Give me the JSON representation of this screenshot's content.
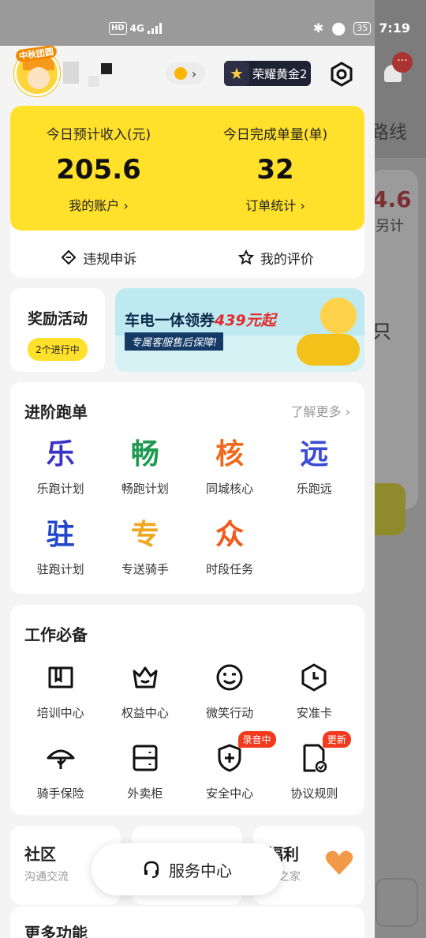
{
  "status_bar": {
    "hd": "HD",
    "network": "4G",
    "battery": "35",
    "time": "7:19"
  },
  "header": {
    "avatar_badge": "中秋团圆",
    "rank_label": "荣耀黄金2"
  },
  "income": {
    "expected_income_label": "今日预计收入(元)",
    "expected_income_value": "205.6",
    "account_link": "我的账户 ›",
    "orders_label": "今日完成单量(单)",
    "orders_value": "32",
    "orders_link": "订单统计 ›",
    "appeal_label": "违规申诉",
    "review_label": "我的评价"
  },
  "reward": {
    "title": "奖励活动",
    "badge": "2个进行中",
    "banner_headline_prefix": "车电一体领券",
    "banner_headline_amount": "439元起",
    "banner_sub": "专属客服售后保障!"
  },
  "advanced": {
    "title": "进阶跑单",
    "more": "了解更多 ›",
    "items": [
      {
        "glyph": "乐",
        "label": "乐跑计划",
        "color": "#3b32c8"
      },
      {
        "glyph": "畅",
        "label": "畅跑计划",
        "color": "#1e9a52"
      },
      {
        "glyph": "核",
        "label": "同城核心",
        "color": "#ef6a1c"
      },
      {
        "glyph": "远",
        "label": "乐跑远",
        "color": "#3a4bd6"
      },
      {
        "glyph": "驻",
        "label": "驻跑计划",
        "color": "#2147c8"
      },
      {
        "glyph": "专",
        "label": "专送骑手",
        "color": "#f0a71d"
      },
      {
        "glyph": "众",
        "label": "时段任务",
        "color": "#f05a1c"
      }
    ]
  },
  "essentials": {
    "title": "工作必备",
    "items": [
      {
        "label": "培训中心",
        "icon": "book-icon"
      },
      {
        "label": "权益中心",
        "icon": "crown-icon"
      },
      {
        "label": "微笑行动",
        "icon": "smile-icon"
      },
      {
        "label": "安准卡",
        "icon": "clock-shield-icon"
      },
      {
        "label": "骑手保险",
        "icon": "umbrella-icon"
      },
      {
        "label": "外卖柜",
        "icon": "locker-icon"
      },
      {
        "label": "安全中心",
        "icon": "shield-plus-icon",
        "tag": "录音中"
      },
      {
        "label": "协议规则",
        "icon": "document-check-icon",
        "tag": "更新"
      }
    ]
  },
  "bottom": {
    "community_title": "社区",
    "community_sub": "沟通交流",
    "welfare_title": "福利",
    "welfare_sub": "手之家",
    "service_center": "服务中心",
    "more_title": "更多功能"
  },
  "background_app": {
    "routes": "路线",
    "number": "4.6",
    "sub": "另计",
    "zhi": "只",
    "dot": "···"
  }
}
